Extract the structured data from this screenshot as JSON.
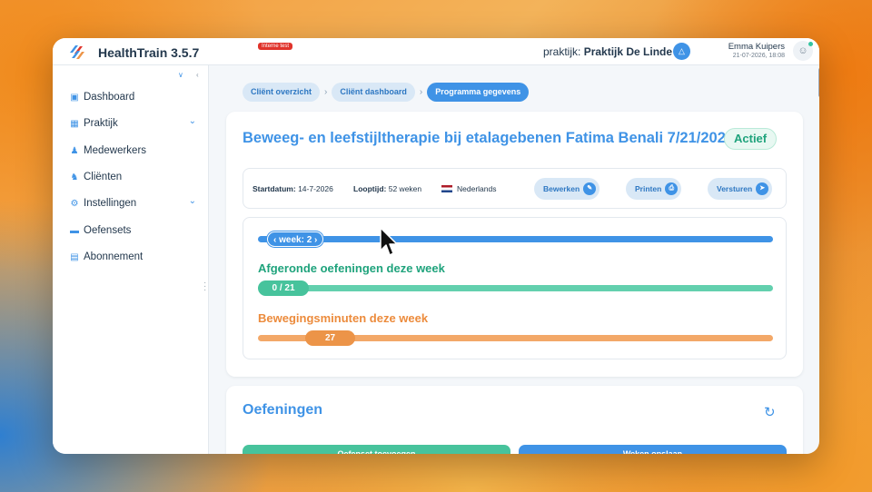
{
  "header": {
    "app_name": "HealthTrain 3.5.7",
    "env_badge": "Interne test",
    "practice_label": "praktijk:",
    "practice_name": "Praktijk De Linde",
    "user_name": "Emma Kuipers",
    "user_datetime": "21-07-2026, 18:08"
  },
  "sidebar": {
    "items": [
      {
        "label": "Dashboard",
        "icon": "dashboard-icon"
      },
      {
        "label": "Praktijk",
        "icon": "store-icon",
        "expandable": true
      },
      {
        "label": "Medewerkers",
        "icon": "users-icon"
      },
      {
        "label": "Cliënten",
        "icon": "clients-icon"
      },
      {
        "label": "Instellingen",
        "icon": "gear-icon",
        "expandable": true
      },
      {
        "label": "Oefensets",
        "icon": "folder-icon"
      },
      {
        "label": "Abonnement",
        "icon": "card-icon"
      }
    ]
  },
  "breadcrumb": [
    "Cliënt overzicht",
    "Cliënt dashboard",
    "Programma gegevens"
  ],
  "program": {
    "title": "Beweeg- en leefstijltherapie bij etalagebenen Fatima Benali 7/21/2026",
    "status": "Actief",
    "start_label": "Startdatum:",
    "start_value": "14-7-2026",
    "duration_label": "Looptijd:",
    "duration_value": "52 weken",
    "language": "Nederlands",
    "buttons": {
      "edit": "Bewerken",
      "print": "Printen",
      "send": "Versturen"
    }
  },
  "progress": {
    "week_label": "week: 2",
    "week_current": 2,
    "exercises_title": "Afgeronde oefeningen deze week",
    "exercises_value": "0 / 21",
    "exercises_done": 0,
    "exercises_total": 21,
    "minutes_title": "Bewegingsminuten deze week",
    "minutes_value": "27"
  },
  "exercises": {
    "title": "Oefeningen",
    "add_button": "Oefenset toevoegen",
    "week_button": "Weken opslaan"
  },
  "colors": {
    "primary": "#3f93e6",
    "green": "#47c39c",
    "orange": "#ec9448",
    "badge_red": "#e0332b"
  }
}
